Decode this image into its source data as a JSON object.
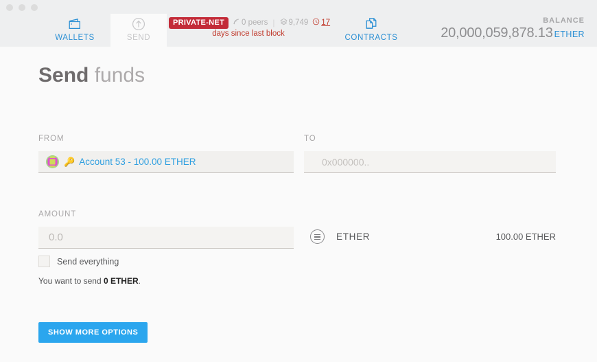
{
  "window": {
    "traffic_lights": [
      "close",
      "minimize",
      "maximize"
    ]
  },
  "header": {
    "tabs": [
      {
        "id": "wallets",
        "label": "WALLETS",
        "icon": "wallet-icon",
        "active": false
      },
      {
        "id": "send",
        "label": "SEND",
        "icon": "arrow-up-circle-icon",
        "active": true
      },
      {
        "id": "contracts",
        "label": "CONTRACTS",
        "icon": "documents-icon",
        "active": false
      }
    ],
    "network": {
      "badge": "PRIVATE-NET",
      "peers": "0 peers",
      "blocks": "9,749",
      "block_age": "17",
      "note": "days since last block",
      "badge_color": "#c32b38",
      "note_color": "#c0392b"
    },
    "balance": {
      "label": "BALANCE",
      "amount": "20,000,059,878.13",
      "unit": "ETHER",
      "unit_color": "#2a8fd4"
    }
  },
  "main": {
    "title_strong": "Send",
    "title_light": " funds",
    "from": {
      "label": "FROM",
      "account_text": "Account 53 - 100.00 ETHER",
      "icons": [
        "identicon",
        "key-icon"
      ]
    },
    "to": {
      "label": "TO",
      "value": "",
      "placeholder": "0x000000.."
    },
    "amount": {
      "label": "AMOUNT",
      "value": "",
      "placeholder": "0.0",
      "send_everything_label": "Send everything",
      "send_everything_checked": false,
      "summary_prefix": "You want to send ",
      "summary_value": "0 ETHER",
      "summary_suffix": "."
    },
    "currency": {
      "icon": "unit-selector-icon",
      "name": "ETHER",
      "available": "100.00 ETHER"
    },
    "show_more_button": {
      "label": "SHOW MORE OPTIONS",
      "color": "#2ba6ee"
    }
  }
}
